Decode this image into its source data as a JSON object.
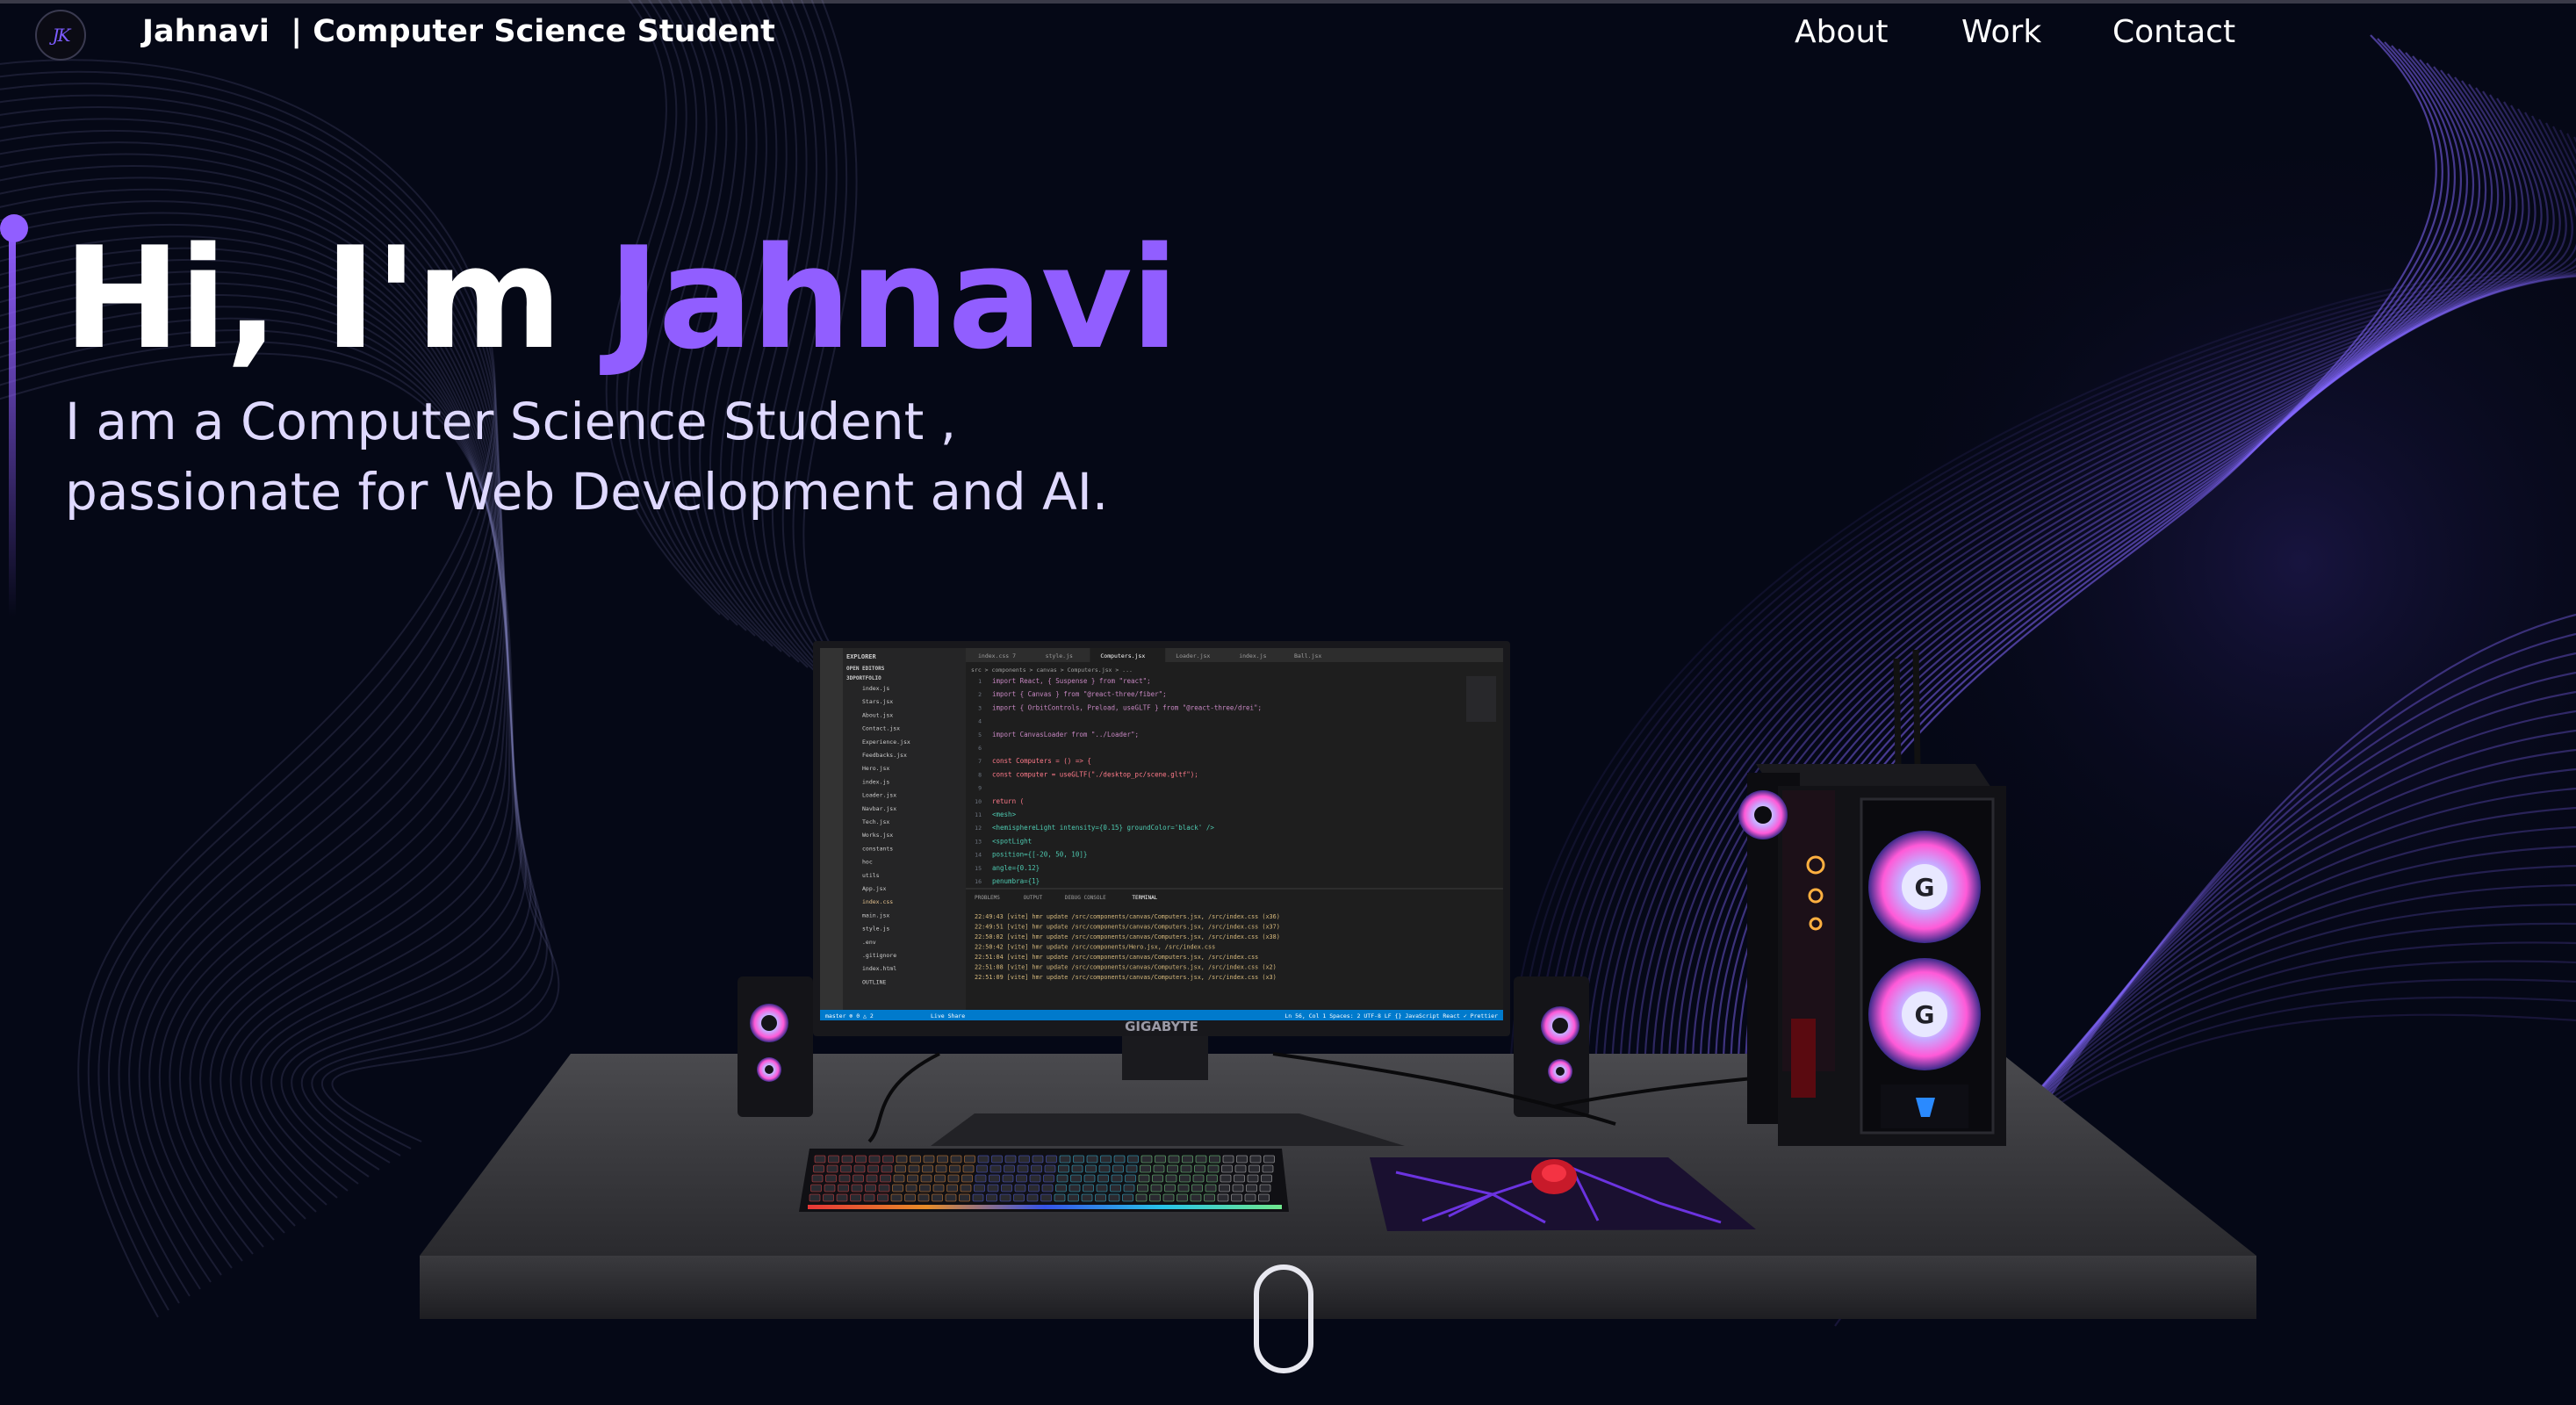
{
  "navbar": {
    "logo_initials": "JK",
    "brand": "Jahnavi  | Computer Science Student",
    "links": [
      {
        "label": "About"
      },
      {
        "label": "Work"
      },
      {
        "label": "Contact"
      }
    ]
  },
  "hero": {
    "greeting": "Hi, I'm ",
    "name": "Jahnavi",
    "subtitle_line1": "I am a Computer Science Student ,",
    "subtitle_line2": "passionate for Web Development and AI."
  },
  "scene": {
    "monitor_brand": "GIGABYTE",
    "editor": {
      "explorer_title": "EXPLORER",
      "open_editors": "OPEN EDITORS",
      "folder": "3DPORTFOLIO",
      "files": [
        "index.js",
        "Stars.jsx",
        "About.jsx",
        "Contact.jsx",
        "Experience.jsx",
        "Feedbacks.jsx",
        "Hero.jsx",
        "index.js",
        "Loader.jsx",
        "Navbar.jsx",
        "Tech.jsx",
        "Works.jsx",
        "constants",
        "hoc",
        "utils",
        "App.jsx",
        "index.css",
        "main.jsx",
        "style.js",
        ".env",
        ".gitignore",
        "index.html",
        "OUTLINE"
      ],
      "tabs": [
        "index.css 7",
        "style.js",
        "Computers.jsx",
        "Loader.jsx",
        "index.js",
        "Ball.jsx"
      ],
      "breadcrumb": "src > components > canvas > Computers.jsx > ...",
      "code_lines": [
        "import React, { Suspense } from \"react\";",
        "import { Canvas } from \"@react-three/fiber\";",
        "import { OrbitControls, Preload, useGLTF } from \"@react-three/drei\";",
        "",
        "import CanvasLoader from \"../Loader\";",
        "",
        "const Computers = () => {",
        "  const computer = useGLTF(\"./desktop_pc/scene.gltf\");",
        "",
        "  return (",
        "    <mesh>",
        "      <hemisphereLight intensity={0.15} groundColor='black' />",
        "      <spotLight",
        "        position={[-20, 50, 10]}",
        "        angle={0.12}",
        "        penumbra={1}"
      ],
      "panel_tabs": [
        "PROBLEMS",
        "OUTPUT",
        "DEBUG CONSOLE",
        "TERMINAL"
      ],
      "terminal_lines": [
        "22:49:43 [vite] hmr update /src/components/canvas/Computers.jsx, /src/index.css (x36)",
        "22:49:51 [vite] hmr update /src/components/canvas/Computers.jsx, /src/index.css (x37)",
        "22:50:02 [vite] hmr update /src/components/canvas/Computers.jsx, /src/index.css (x38)",
        "22:50:42 [vite] hmr update /src/components/Hero.jsx, /src/index.css",
        "22:51:04 [vite] hmr update /src/components/canvas/Computers.jsx, /src/index.css",
        "22:51:08 [vite] hmr update /src/components/canvas/Computers.jsx, /src/index.css (x2)",
        "22:51:09 [vite] hmr update /src/components/canvas/Computers.jsx, /src/index.css (x3)"
      ],
      "status_left": "master   ⊗ 0 △ 2",
      "status_live": "Live Share",
      "status_right": "Ln 56, Col 1   Spaces: 2   UTF-8   LF   {} JavaScript React   ✓ Prettier"
    }
  },
  "colors": {
    "background": "#050816",
    "accent": "#915eff",
    "text": "#ffffff",
    "subtitle": "#dfd9ff"
  }
}
